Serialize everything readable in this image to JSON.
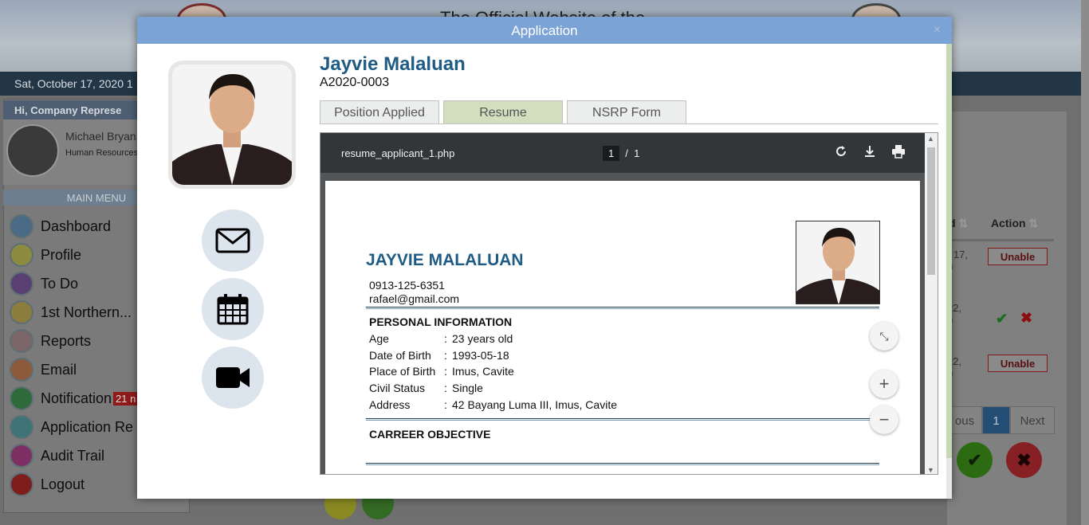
{
  "background": {
    "header_title": "The Official Website of the",
    "date": "Sat, October 17, 2020 1",
    "greeting": "Hi, Company Represe",
    "user_name": "Michael Bryan",
    "user_role": "Human Resources",
    "menu_title": "MAIN MENU",
    "menu": [
      {
        "label": "Dashboard",
        "icon": "dashboard-icon"
      },
      {
        "label": "Profile",
        "icon": "profile-icon"
      },
      {
        "label": "To Do",
        "icon": "todo-icon"
      },
      {
        "label": "1st Northern...",
        "icon": "building-icon"
      },
      {
        "label": "Reports",
        "icon": "reports-icon"
      },
      {
        "label": "Email",
        "icon": "email-icon"
      },
      {
        "label": "Notification",
        "icon": "bell-icon",
        "badge": "21 n"
      },
      {
        "label": "Application Re",
        "icon": "bookmark-icon"
      },
      {
        "label": "Audit Trail",
        "icon": "audit-icon"
      },
      {
        "label": "Logout",
        "icon": "power-icon"
      }
    ],
    "table": {
      "col_d": "d",
      "col_action": "Action",
      "rows": [
        {
          "date": "r 17,\n0",
          "action": "Unable"
        },
        {
          "date": "22,\n0",
          "action": ""
        },
        {
          "date": "22,\n0",
          "action": "Unable"
        }
      ],
      "pager_prev": "ous",
      "pager_page": "1",
      "pager_next": "Next"
    }
  },
  "modal": {
    "title": "Application",
    "close": "×",
    "applicant_name": "Jayvie Malaluan",
    "applicant_id": "A2020-0003",
    "tabs": [
      "Position Applied",
      "Resume",
      "NSRP Form"
    ],
    "active_tab": "Resume",
    "viewer": {
      "file_name": "resume_applicant_1.php",
      "page_current": "1",
      "page_sep": "/",
      "page_total": "1"
    },
    "resume": {
      "name": "JAYVIE MALALUAN",
      "phone": "0913-125-6351",
      "email": "rafael@gmail.com",
      "personal_heading": "PERSONAL INFORMATION",
      "fields": [
        {
          "label": "Age",
          "value": "23 years old"
        },
        {
          "label": "Date of Birth",
          "value": "1993-05-18"
        },
        {
          "label": "Place of Birth",
          "value": "Imus, Cavite"
        },
        {
          "label": "Civil Status",
          "value": "Single"
        },
        {
          "label": "Address",
          "value": "42 Bayang Luma III, Imus, Cavite"
        }
      ],
      "objective_heading": "CARREER OBJECTIVE"
    }
  },
  "colors": {
    "accent_blue": "#7ba3d6",
    "name_blue": "#1f5c85",
    "tab_active": "#d2dfbe"
  }
}
